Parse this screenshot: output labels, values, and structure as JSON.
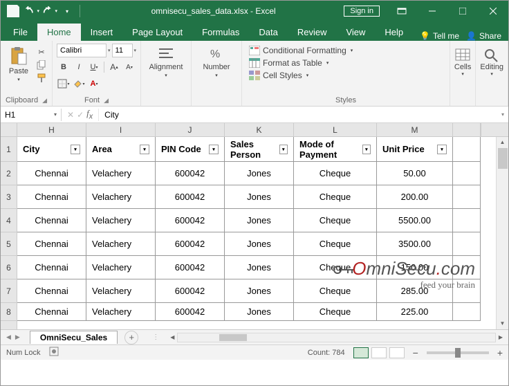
{
  "title": "omnisecu_sales_data.xlsx - Excel",
  "signin": "Sign in",
  "tabs": {
    "file": "File",
    "home": "Home",
    "insert": "Insert",
    "pagelayout": "Page Layout",
    "formulas": "Formulas",
    "data": "Data",
    "review": "Review",
    "view": "View",
    "help": "Help"
  },
  "tellme": "Tell me",
  "share": "Share",
  "ribbon": {
    "clipboard": {
      "paste": "Paste",
      "label": "Clipboard"
    },
    "font": {
      "name": "Calibri",
      "size": "11",
      "label": "Font"
    },
    "alignment": {
      "label": "Alignment"
    },
    "number": {
      "label": "Number"
    },
    "styles": {
      "cond": "Conditional Formatting",
      "table": "Format as Table",
      "cell": "Cell Styles",
      "label": "Styles"
    },
    "cells": {
      "label": "Cells"
    },
    "editing": {
      "label": "Editing"
    }
  },
  "namebox": "H1",
  "formula": "City",
  "cols": [
    "H",
    "I",
    "J",
    "K",
    "L",
    "M"
  ],
  "rowNums": [
    "1",
    "2",
    "3",
    "4",
    "5",
    "6",
    "7",
    "8"
  ],
  "headers": {
    "H": "City",
    "I": "Area",
    "J": "PIN Code",
    "K": "Sales Person",
    "L": "Mode of Payment",
    "M": "Unit Price"
  },
  "rows": [
    {
      "H": "Chennai",
      "I": "Velachery",
      "J": "600042",
      "K": "Jones",
      "L": "Cheque",
      "M": "50.00"
    },
    {
      "H": "Chennai",
      "I": "Velachery",
      "J": "600042",
      "K": "Jones",
      "L": "Cheque",
      "M": "200.00"
    },
    {
      "H": "Chennai",
      "I": "Velachery",
      "J": "600042",
      "K": "Jones",
      "L": "Cheque",
      "M": "5500.00"
    },
    {
      "H": "Chennai",
      "I": "Velachery",
      "J": "600042",
      "K": "Jones",
      "L": "Cheque",
      "M": "3500.00"
    },
    {
      "H": "Chennai",
      "I": "Velachery",
      "J": "600042",
      "K": "Jones",
      "L": "Cheque",
      "M": "150.00"
    },
    {
      "H": "Chennai",
      "I": "Velachery",
      "J": "600042",
      "K": "Jones",
      "L": "Cheque",
      "M": "285.00"
    },
    {
      "H": "Chennai",
      "I": "Velachery",
      "J": "600042",
      "K": "Jones",
      "L": "Cheque",
      "M": "225.00"
    }
  ],
  "sheet": "OmniSecu_Sales",
  "status": {
    "numlock": "Num Lock",
    "count_label": "Count:",
    "count": "784"
  },
  "zoom": {
    "minus": "−",
    "plus": "+"
  },
  "watermark": {
    "brand_pre": "O",
    "brand_mid": "mniSecu",
    "brand_dot": ".",
    "brand_suf": "com",
    "tag": "feed your brain"
  }
}
